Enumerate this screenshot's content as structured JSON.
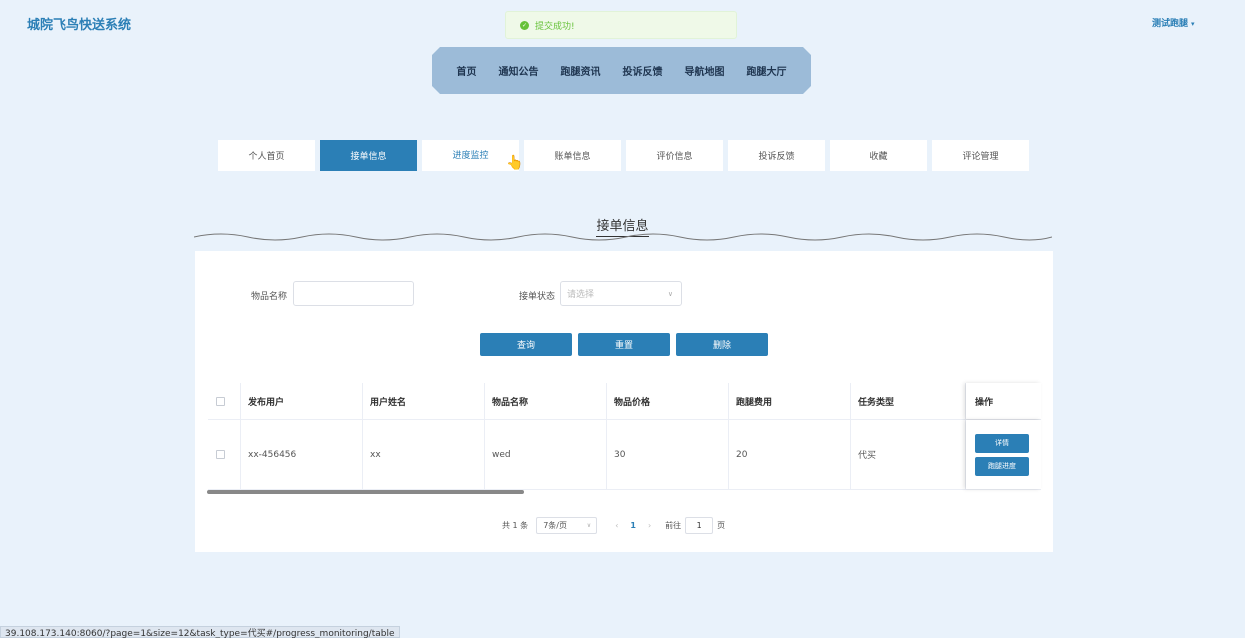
{
  "header": {
    "logo": "城院飞鸟快送系统",
    "user_menu": "测试跑腿",
    "user_caret": "▾"
  },
  "toast": {
    "message": "提交成功!",
    "icon": "✓"
  },
  "topnav": {
    "items": [
      "首页",
      "通知公告",
      "跑腿资讯",
      "投诉反馈",
      "导航地图",
      "跑腿大厅"
    ]
  },
  "subtabs": {
    "items": [
      "个人首页",
      "接单信息",
      "进度监控",
      "账单信息",
      "评价信息",
      "投诉反馈",
      "收藏",
      "评论管理"
    ],
    "active": "接单信息",
    "hovered": "进度监控"
  },
  "section_title": "接单信息",
  "filters": {
    "item_name_label": "物品名称",
    "item_name_value": "",
    "status_label": "接单状态",
    "status_placeholder": "请选择"
  },
  "actions": {
    "query": "查询",
    "reset": "重置",
    "delete": "删除"
  },
  "table": {
    "columns": [
      "发布用户",
      "用户姓名",
      "物品名称",
      "物品价格",
      "跑腿费用",
      "任务类型",
      "操作"
    ],
    "rows": [
      {
        "publisher": "xx-456456",
        "user_name": "xx",
        "item_name": "wed",
        "item_price": "30",
        "fee": "20",
        "task_type": "代买",
        "btn_detail": "详情",
        "btn_progress": "跑腿进度"
      }
    ]
  },
  "pagination": {
    "total": "共 1 条",
    "page_size": "7条/页",
    "prev": "‹",
    "current": "1",
    "next": "›",
    "goto_label": "前往",
    "goto_value": "1",
    "page_suffix": "页"
  },
  "statusbar": {
    "url": "39.108.173.140:8060/?page=1&size=12&task_type=代买#/progress_monitoring/table"
  },
  "colors": {
    "primary": "#2b7fb6",
    "nav_bg": "#9cbbd8",
    "page_bg": "#e9f2fb",
    "success": "#67c23a"
  }
}
